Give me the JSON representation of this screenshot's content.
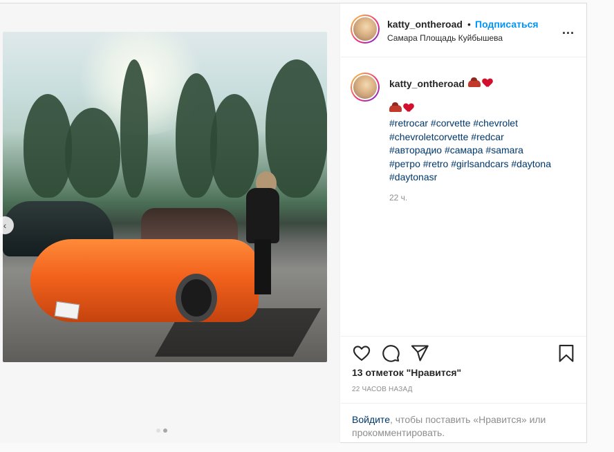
{
  "post": {
    "username": "katty_ontheroad",
    "separator": "•",
    "follow_label": "Подписаться",
    "location": "Самара Площадь Куйбышева",
    "more_label": "..."
  },
  "caption": {
    "username": "katty_ontheroad",
    "hashtags": [
      "#retrocar #corvette #chevrolet",
      "#chevroletcorvette #redcar",
      "#авторадио #самара #samara",
      "#ретро #retro #girlsandcars #daytona",
      "#daytonasr"
    ],
    "time": "22 ч."
  },
  "media": {
    "prev_label": "‹",
    "carousel_total": 2,
    "carousel_active": 2
  },
  "actions": {
    "like_icon": "heart-outline-icon",
    "comment_icon": "comment-bubble-icon",
    "share_icon": "paper-plane-icon",
    "save_icon": "bookmark-icon"
  },
  "likes_text": "13 отметок \"Нравится\"",
  "posted_ago": "22 ЧАСОВ НАЗАД",
  "login_prompt": {
    "link": "Войдите",
    "rest": ", чтобы поставить «Нравится» или прокомментировать."
  },
  "colors": {
    "accent": "#0095f6",
    "link": "#00376b",
    "muted": "#8e8e8e"
  }
}
